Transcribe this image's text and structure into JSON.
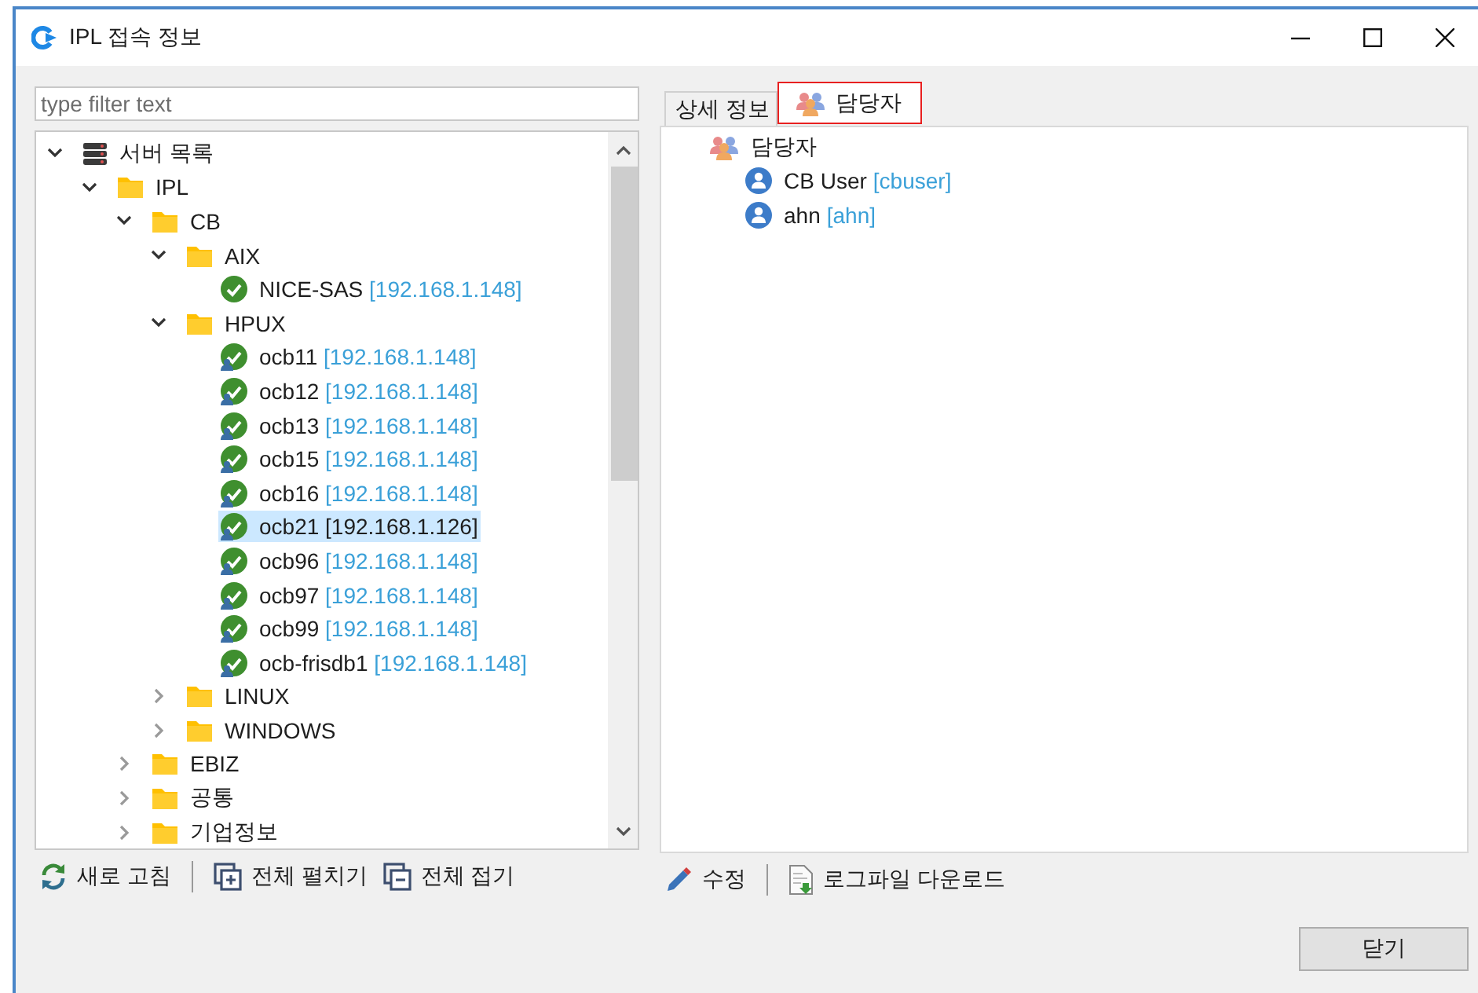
{
  "window": {
    "title": "IPL 접속 정보"
  },
  "filter": {
    "placeholder": "type filter text"
  },
  "tree": [
    {
      "kind": "servers",
      "label": "서버 목록",
      "expanded": true,
      "selected": false,
      "children": [
        {
          "kind": "folder",
          "label": "IPL",
          "expanded": true,
          "selected": false,
          "children": [
            {
              "kind": "folder",
              "label": "CB",
              "expanded": true,
              "selected": false,
              "children": [
                {
                  "kind": "folder",
                  "label": "AIX",
                  "expanded": true,
                  "selected": false,
                  "children": [
                    {
                      "kind": "host",
                      "label": "NICE-SAS",
                      "address": "[192.168.1.148]",
                      "selected": false
                    }
                  ]
                },
                {
                  "kind": "folder",
                  "label": "HPUX",
                  "expanded": true,
                  "selected": false,
                  "children": [
                    {
                      "kind": "host-user",
                      "label": "ocb11",
                      "address": "[192.168.1.148]",
                      "selected": false
                    },
                    {
                      "kind": "host-user",
                      "label": "ocb12",
                      "address": "[192.168.1.148]",
                      "selected": false
                    },
                    {
                      "kind": "host-user",
                      "label": "ocb13",
                      "address": "[192.168.1.148]",
                      "selected": false
                    },
                    {
                      "kind": "host-user",
                      "label": "ocb15",
                      "address": "[192.168.1.148]",
                      "selected": false
                    },
                    {
                      "kind": "host-user",
                      "label": "ocb16",
                      "address": "[192.168.1.148]",
                      "selected": false
                    },
                    {
                      "kind": "host-user",
                      "label": "ocb21",
                      "address": "[192.168.1.126]",
                      "selected": true
                    },
                    {
                      "kind": "host-user",
                      "label": "ocb96",
                      "address": "[192.168.1.148]",
                      "selected": false
                    },
                    {
                      "kind": "host-user",
                      "label": "ocb97",
                      "address": "[192.168.1.148]",
                      "selected": false
                    },
                    {
                      "kind": "host-user",
                      "label": "ocb99",
                      "address": "[192.168.1.148]",
                      "selected": false
                    },
                    {
                      "kind": "host-user",
                      "label": "ocb-frisdb1",
                      "address": "[192.168.1.148]",
                      "selected": false
                    }
                  ]
                },
                {
                  "kind": "folder",
                  "label": "LINUX",
                  "expanded": false,
                  "selected": false
                },
                {
                  "kind": "folder",
                  "label": "WINDOWS",
                  "expanded": false,
                  "selected": false
                }
              ]
            },
            {
              "kind": "folder",
              "label": "EBIZ",
              "expanded": false,
              "selected": false
            },
            {
              "kind": "folder",
              "label": "공통",
              "expanded": false,
              "selected": false
            },
            {
              "kind": "folder",
              "label": "기업정보",
              "expanded": false,
              "selected": false
            }
          ]
        }
      ]
    }
  ],
  "tree_toolbar": [
    {
      "kind": "refresh",
      "label": "새로 고침"
    },
    {
      "kind": "separator"
    },
    {
      "kind": "expand-all",
      "label": "전체 펼치기"
    },
    {
      "kind": "collapse-all",
      "label": "전체 접기"
    }
  ],
  "tabs": [
    {
      "kind": "text",
      "label": "상세 정보",
      "selected": false
    },
    {
      "kind": "people",
      "label": "담당자",
      "selected": true
    }
  ],
  "contacts": [
    {
      "kind": "group",
      "label": "담당자",
      "children": [
        {
          "kind": "user",
          "label": "CB User",
          "account": "[cbuser]"
        },
        {
          "kind": "user",
          "label": "ahn",
          "account": "[ahn]"
        }
      ]
    }
  ],
  "detail_toolbar": [
    {
      "kind": "edit",
      "label": "수정"
    },
    {
      "kind": "separator"
    },
    {
      "kind": "download-log",
      "label": "로그파일 다운로드"
    }
  ],
  "buttons": [
    {
      "label": "닫기"
    }
  ]
}
